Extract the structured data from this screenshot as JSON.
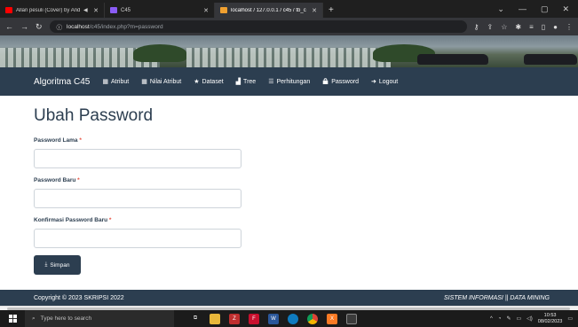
{
  "browser": {
    "tabs": [
      {
        "label": "Allan pesuli (Cover) by Andy",
        "favicon_color": "#ff0000",
        "audio": "◀"
      },
      {
        "label": "C45",
        "favicon_color": "#8a5cf6",
        "audio": ""
      },
      {
        "label": "localhost / 127.0.0.1 / c45 / tb_c",
        "favicon_color": "#f0a030",
        "audio": ""
      }
    ],
    "new_tab": "+",
    "url_host": "localhost",
    "url_path": "/c45/index.php?m=password"
  },
  "nav": {
    "brand": "Algoritma C45",
    "items": [
      {
        "label": "Atribut",
        "icon": "grid-icon",
        "glyph": "▦"
      },
      {
        "label": "Nilai Atribut",
        "icon": "grid-small-icon",
        "glyph": "▦"
      },
      {
        "label": "Dataset",
        "icon": "star-icon",
        "glyph": "★"
      },
      {
        "label": "Tree",
        "icon": "signal-icon",
        "glyph": "▟"
      },
      {
        "label": "Perhitungan",
        "icon": "list-icon",
        "glyph": "☰"
      },
      {
        "label": "Password",
        "icon": "lock-icon",
        "glyph": "🔒"
      },
      {
        "label": "Logout",
        "icon": "logout-icon",
        "glyph": "➜"
      }
    ]
  },
  "page": {
    "title": "Ubah Password",
    "fields": [
      {
        "label": "Password Lama",
        "required": "*",
        "value": ""
      },
      {
        "label": "Password Baru",
        "required": "*",
        "value": ""
      },
      {
        "label": "Konfirmasi Password Baru",
        "required": "*",
        "value": ""
      }
    ],
    "submit_label": "Simpan"
  },
  "footer": {
    "left": "Copyright © 2023 SKRIPSI 2022",
    "right": "SISTEM INFORMASI || DATA MINING"
  },
  "taskbar": {
    "search_placeholder": "Type here to search",
    "time": "10:53",
    "date": "08/02/2023"
  },
  "colors": {
    "navbar": "#2c3e50",
    "required": "#e74c3c"
  }
}
